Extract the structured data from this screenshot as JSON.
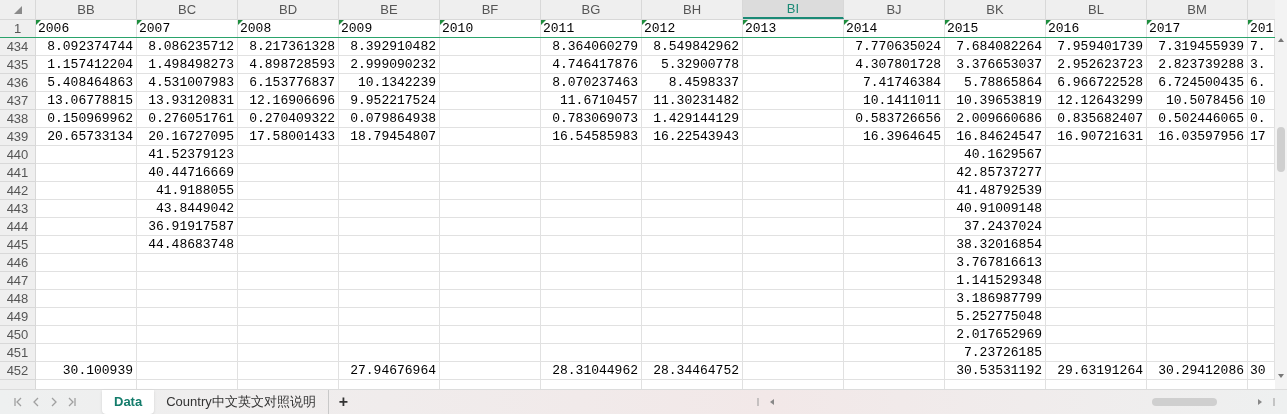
{
  "columns": [
    {
      "letter": "BB",
      "selected": false
    },
    {
      "letter": "BC",
      "selected": false
    },
    {
      "letter": "BD",
      "selected": false
    },
    {
      "letter": "BE",
      "selected": false
    },
    {
      "letter": "BF",
      "selected": false
    },
    {
      "letter": "BG",
      "selected": false
    },
    {
      "letter": "BH",
      "selected": false
    },
    {
      "letter": "BI",
      "selected": true
    },
    {
      "letter": "BJ",
      "selected": false
    },
    {
      "letter": "BK",
      "selected": false
    },
    {
      "letter": "BL",
      "selected": false
    },
    {
      "letter": "BM",
      "selected": false
    }
  ],
  "header_row": {
    "number": "1",
    "cells": [
      {
        "text": "2006",
        "flagged": true
      },
      {
        "text": "2007",
        "flagged": true
      },
      {
        "text": "2008",
        "flagged": true
      },
      {
        "text": "2009",
        "flagged": true
      },
      {
        "text": "2010",
        "flagged": true
      },
      {
        "text": "2011",
        "flagged": true
      },
      {
        "text": "2012",
        "flagged": true
      },
      {
        "text": "2013",
        "flagged": true
      },
      {
        "text": "2014",
        "flagged": true
      },
      {
        "text": "2015",
        "flagged": true
      },
      {
        "text": "2016",
        "flagged": true
      },
      {
        "text": "2017",
        "flagged": true
      },
      {
        "text": "201",
        "flagged": true
      }
    ]
  },
  "rows": [
    {
      "number": "434",
      "cells": [
        "8.092374744",
        "8.086235712",
        "8.217361328",
        "8.392910482",
        null,
        "8.364060279",
        "8.549842962",
        null,
        "7.770635024",
        "7.684082264",
        "7.959401739",
        "7.319455939",
        "7."
      ]
    },
    {
      "number": "435",
      "cells": [
        "1.157412204",
        "1.498498273",
        "4.898728593",
        "2.999090232",
        null,
        "4.746417876",
        "5.32900778",
        null,
        "4.307801728",
        "3.376653037",
        "2.952623723",
        "2.823739288",
        "3."
      ]
    },
    {
      "number": "436",
      "cells": [
        "5.408464863",
        "4.531007983",
        "6.153776837",
        "10.1342239",
        null,
        "8.070237463",
        "8.4598337",
        null,
        "7.41746384",
        "5.78865864",
        "6.966722528",
        "6.724500435",
        "6."
      ]
    },
    {
      "number": "437",
      "cells": [
        "13.06778815",
        "13.93120831",
        "12.16906696",
        "9.952217524",
        null,
        "11.6710457",
        "11.30231482",
        null,
        "10.1411011",
        "10.39653819",
        "12.12643299",
        "10.5078456",
        "10"
      ]
    },
    {
      "number": "438",
      "cells": [
        "0.150969962",
        "0.276051761",
        "0.270409322",
        "0.079864938",
        null,
        "0.783069073",
        "1.429144129",
        null,
        "0.583726656",
        "2.009660686",
        "0.835682407",
        "0.502446065",
        "0."
      ]
    },
    {
      "number": "439",
      "cells": [
        "20.65733134",
        "20.16727095",
        "17.58001433",
        "18.79454807",
        null,
        "16.54585983",
        "16.22543943",
        null,
        "16.3964645",
        "16.84624547",
        "16.90721631",
        "16.03597956",
        "17"
      ]
    },
    {
      "number": "440",
      "cells": [
        null,
        "41.52379123",
        null,
        null,
        null,
        null,
        null,
        null,
        null,
        "40.1629567",
        null,
        null,
        null
      ]
    },
    {
      "number": "441",
      "cells": [
        null,
        "40.44716669",
        null,
        null,
        null,
        null,
        null,
        null,
        null,
        "42.85737277",
        null,
        null,
        null
      ]
    },
    {
      "number": "442",
      "cells": [
        null,
        "41.9188055",
        null,
        null,
        null,
        null,
        null,
        null,
        null,
        "41.48792539",
        null,
        null,
        null
      ]
    },
    {
      "number": "443",
      "cells": [
        null,
        "43.8449042",
        null,
        null,
        null,
        null,
        null,
        null,
        null,
        "40.91009148",
        null,
        null,
        null
      ]
    },
    {
      "number": "444",
      "cells": [
        null,
        "36.91917587",
        null,
        null,
        null,
        null,
        null,
        null,
        null,
        "37.2437024",
        null,
        null,
        null
      ]
    },
    {
      "number": "445",
      "cells": [
        null,
        "44.48683748",
        null,
        null,
        null,
        null,
        null,
        null,
        null,
        "38.32016854",
        null,
        null,
        null
      ]
    },
    {
      "number": "446",
      "cells": [
        null,
        null,
        null,
        null,
        null,
        null,
        null,
        null,
        null,
        "3.767816613",
        null,
        null,
        null
      ]
    },
    {
      "number": "447",
      "cells": [
        null,
        null,
        null,
        null,
        null,
        null,
        null,
        null,
        null,
        "1.141529348",
        null,
        null,
        null
      ]
    },
    {
      "number": "448",
      "cells": [
        null,
        null,
        null,
        null,
        null,
        null,
        null,
        null,
        null,
        "3.186987799",
        null,
        null,
        null
      ]
    },
    {
      "number": "449",
      "cells": [
        null,
        null,
        null,
        null,
        null,
        null,
        null,
        null,
        null,
        "5.252775048",
        null,
        null,
        null
      ]
    },
    {
      "number": "450",
      "cells": [
        null,
        null,
        null,
        null,
        null,
        null,
        null,
        null,
        null,
        "2.017652969",
        null,
        null,
        null
      ]
    },
    {
      "number": "451",
      "cells": [
        null,
        null,
        null,
        null,
        null,
        null,
        null,
        null,
        null,
        "7.23726185",
        null,
        null,
        null
      ]
    },
    {
      "number": "452",
      "cells": [
        "30.100939",
        null,
        null,
        "27.94676964",
        null,
        "28.31044962",
        "28.34464752",
        null,
        null,
        "30.53531192",
        "29.63191264",
        "30.29412086",
        "30"
      ]
    }
  ],
  "sheet_tabs": [
    {
      "label": "Data",
      "selected": true
    },
    {
      "label": "Country中文英文对照说明",
      "selected": false
    }
  ],
  "add_sheet_button": "+"
}
